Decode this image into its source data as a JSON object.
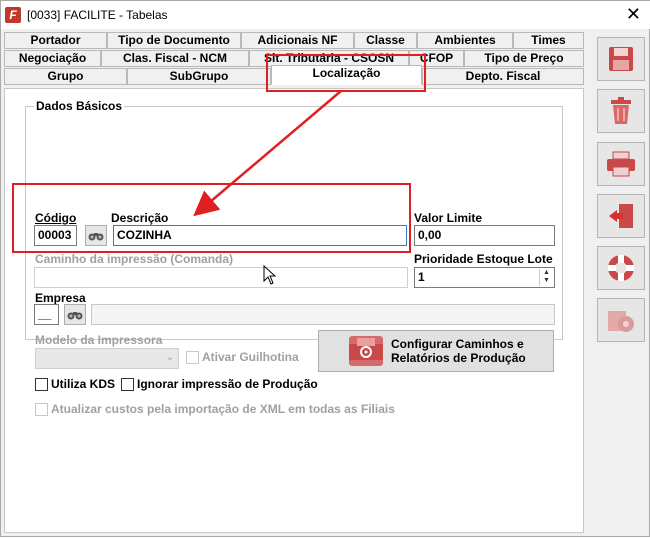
{
  "window": {
    "title": "[0033] FACILITE - Tabelas",
    "app_icon_letter": "F"
  },
  "tabs": {
    "row1": [
      "Portador",
      "Tipo de Documento",
      "Adicionais NF",
      "Classe",
      "Ambientes",
      "Times"
    ],
    "row2": [
      "Negociação",
      "Clas. Fiscal - NCM",
      "Sit. Tributária - CSOSN",
      "CFOP",
      "Tipo de Preço"
    ],
    "row3": [
      "Grupo",
      "SubGrupo",
      "Localização",
      "Depto. Fiscal"
    ],
    "active": "Localização"
  },
  "form": {
    "group_title": "Dados Básicos",
    "codigo_label": "Código",
    "codigo_value": "00003",
    "descricao_label": "Descrição",
    "descricao_value": "COZINHA",
    "valor_limite_label": "Valor Limite",
    "valor_limite_value": "0,00",
    "caminho_label": "Caminho da impressão (Comanda)",
    "caminho_value": "",
    "prioridade_label": "Prioridade Estoque Lote",
    "prioridade_value": "1",
    "empresa_label": "Empresa",
    "empresa_value": "__",
    "empresa_name": "",
    "modelo_label": "Modelo da Impressora",
    "modelo_value": "",
    "guilhotina_label": "Ativar Guilhotina",
    "configurar_label_1": "Configurar Caminhos e",
    "configurar_label_2": "Relatórios de Produção",
    "kds_label": "Utiliza KDS",
    "ignorar_label": "Ignorar impressão de Produção",
    "atualizar_label": "Atualizar custos pela importação de XML em todas as Filiais"
  },
  "toolbar": {
    "buttons": [
      "save-icon",
      "trash-icon",
      "printer-icon",
      "exit-door-icon",
      "help-lifebuoy-icon",
      "settings-gear-icon"
    ]
  },
  "colors": {
    "annotation": "#e02020",
    "accent": "#c0392b"
  }
}
